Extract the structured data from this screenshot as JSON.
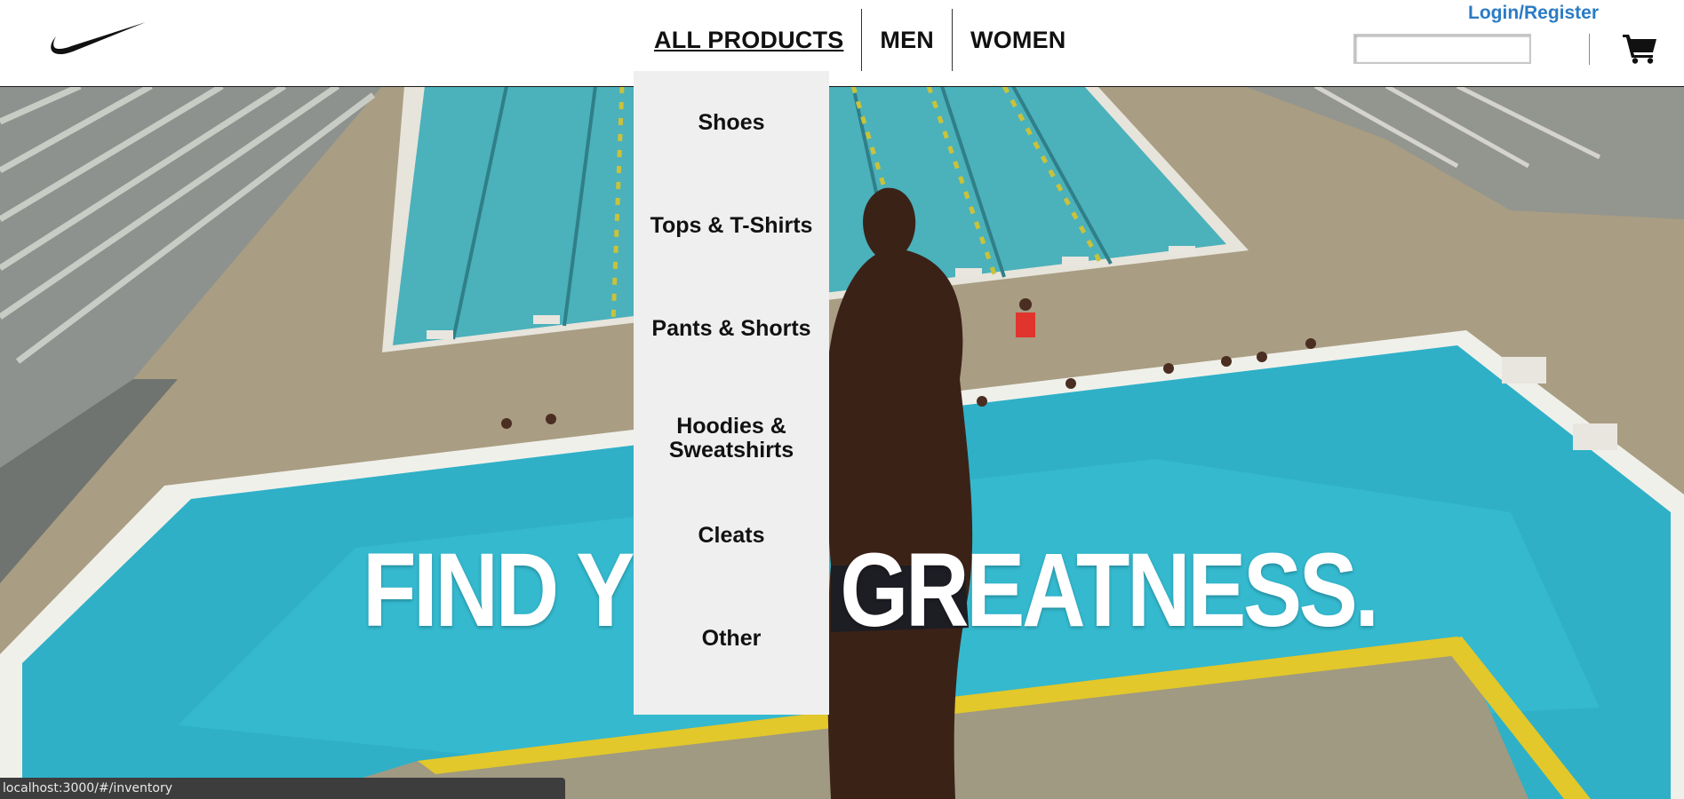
{
  "header": {
    "logo_icon": "nike-swoosh-icon",
    "nav": {
      "all_products": "ALL PRODUCTS",
      "men": "MEN",
      "women": "WOMEN"
    },
    "login_link": "Login/Register",
    "search": {
      "value": "",
      "placeholder": ""
    },
    "cart_icon": "shopping-cart-icon"
  },
  "dropdown": {
    "items": [
      {
        "label": "Shoes"
      },
      {
        "label": "Tops & T-Shirts"
      },
      {
        "label": "Pants & Shorts"
      },
      {
        "label": "Hoodies & Sweatshirts"
      },
      {
        "label": "Cleats"
      },
      {
        "label": "Other"
      }
    ]
  },
  "hero": {
    "headline": "FIND YOUR GREATNESS."
  },
  "statusbar": {
    "url": "localhost:3000/#/inventory"
  },
  "colors": {
    "link_blue": "#2b7bc4",
    "dropdown_bg": "#efefef",
    "pool_blue": "#3a9fb2"
  }
}
